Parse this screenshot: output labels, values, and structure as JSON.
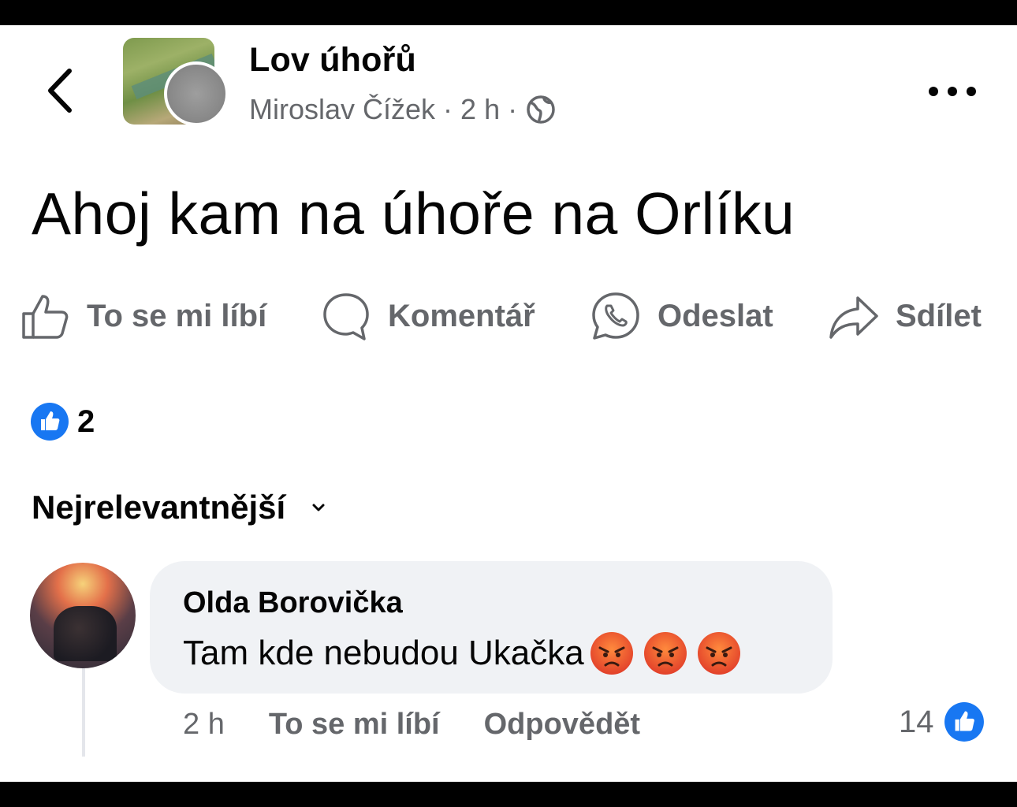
{
  "header": {
    "group_name": "Lov úhořů",
    "author": "Miroslav Čížek",
    "separator": "·",
    "time": "2 h",
    "icons": {
      "back": "chevron-left-icon",
      "privacy": "globe-icon",
      "more": "more-horizontal-icon"
    }
  },
  "post": {
    "text": "Ahoj kam na úhoře na Orlíku"
  },
  "actions": {
    "like": "To se mi líbí",
    "comment": "Komentář",
    "send": "Odeslat",
    "share": "Sdílet"
  },
  "reactions": {
    "count": "2"
  },
  "comments_sort": {
    "label": "Nejrelevantnější"
  },
  "comment": {
    "author": "Olda Borovička",
    "text": "Tam kde nebudou Ukačka",
    "emoji": [
      "angry-face-icon",
      "angry-face-icon",
      "angry-face-icon"
    ],
    "time": "2 h",
    "like_label": "To se mi líbí",
    "reply_label": "Odpovědět",
    "like_count": "14"
  },
  "colors": {
    "text": "#050505",
    "secondary": "#65676b",
    "brand_blue": "#1877f2",
    "bubble": "#f0f2f5"
  }
}
